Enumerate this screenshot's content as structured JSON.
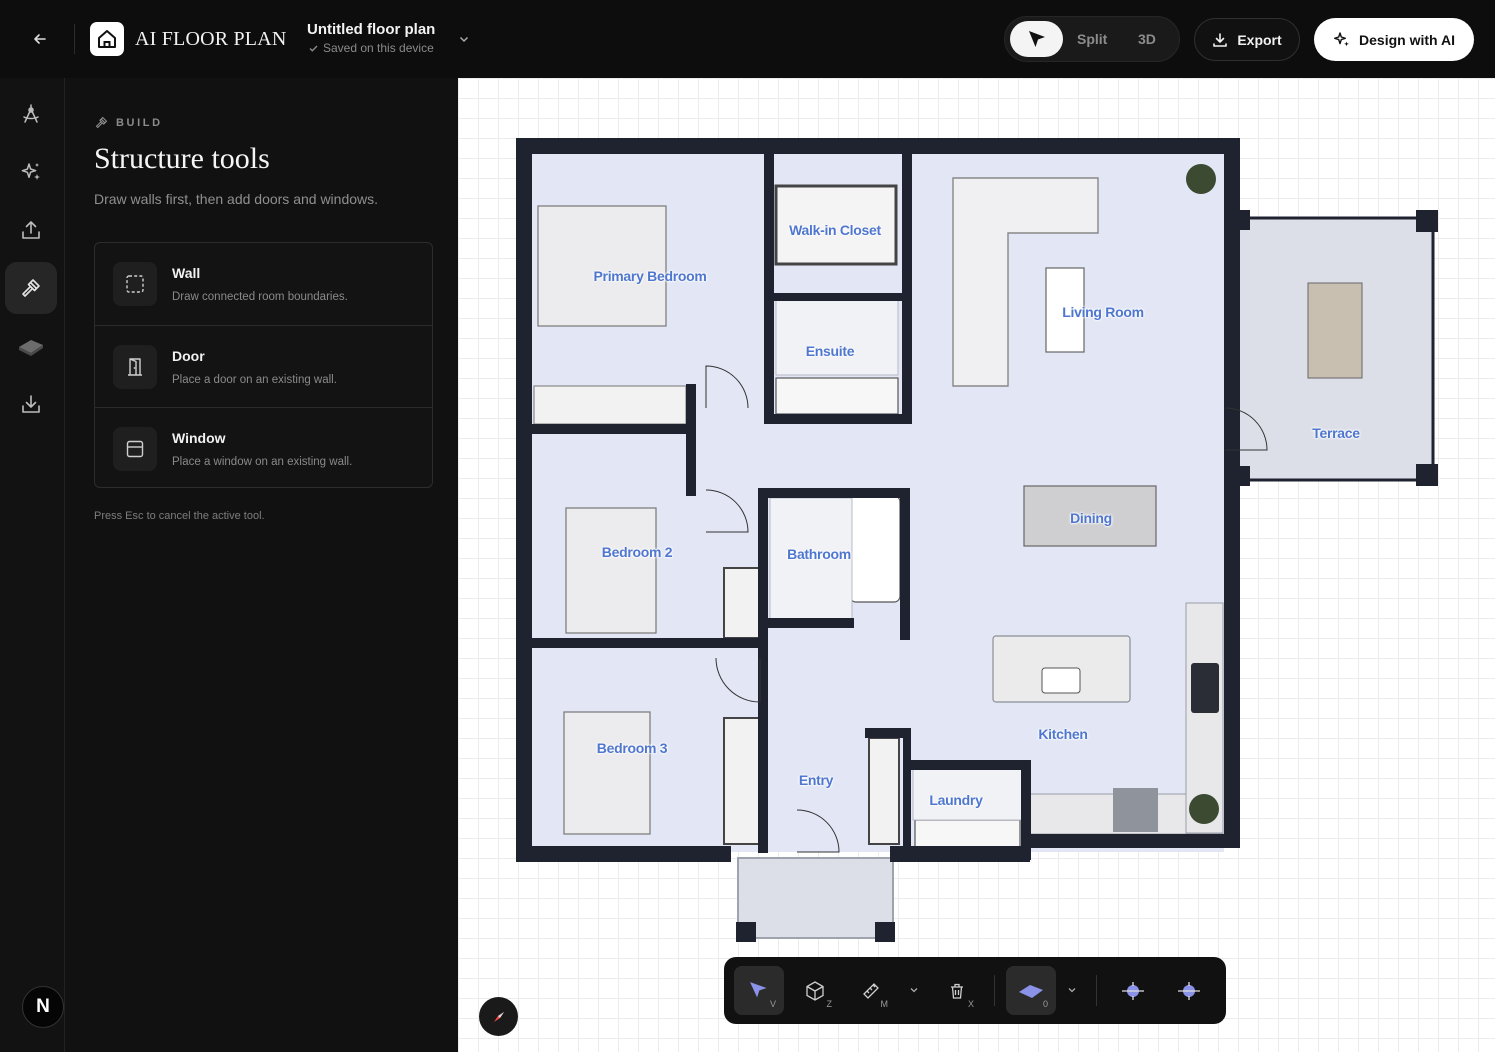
{
  "header": {
    "logo_text": "AI FLOOR PLAN",
    "doc_title": "Untitled floor plan",
    "save_status": "Saved on this device",
    "view_modes": [
      "Split",
      "3D"
    ],
    "export_label": "Export",
    "ai_label": "Design with AI"
  },
  "rail": {
    "icons": [
      "draw-tools-icon",
      "sparkles-icon",
      "upload-icon",
      "hammer-icon",
      "material-icon",
      "download-icon"
    ],
    "active": "hammer-icon",
    "avatar_initial": "N"
  },
  "panel": {
    "kicker": "BUILD",
    "title": "Structure tools",
    "subtitle": "Draw walls first, then add doors and windows.",
    "tools": [
      {
        "name": "Wall",
        "desc": "Draw connected room boundaries."
      },
      {
        "name": "Door",
        "desc": "Place a door on an existing wall."
      },
      {
        "name": "Window",
        "desc": "Place a window on an existing wall."
      }
    ],
    "hint": "Press Esc to cancel the active tool."
  },
  "plan": {
    "rooms": [
      "Walk-in Closet",
      "Primary Bedroom",
      "Living Room",
      "Ensuite",
      "Terrace",
      "Dining",
      "Bedroom 2",
      "Bathroom",
      "Kitchen",
      "Bedroom 3",
      "Entry",
      "Laundry"
    ],
    "colors": {
      "room_fill": "#e2e6f5",
      "wall": "#1f2330",
      "label": "#4f77cf"
    }
  },
  "toolbar": {
    "keys": {
      "select": "V",
      "zoom": "Z",
      "measure": "M",
      "delete": "X"
    },
    "floor_level": "0"
  }
}
